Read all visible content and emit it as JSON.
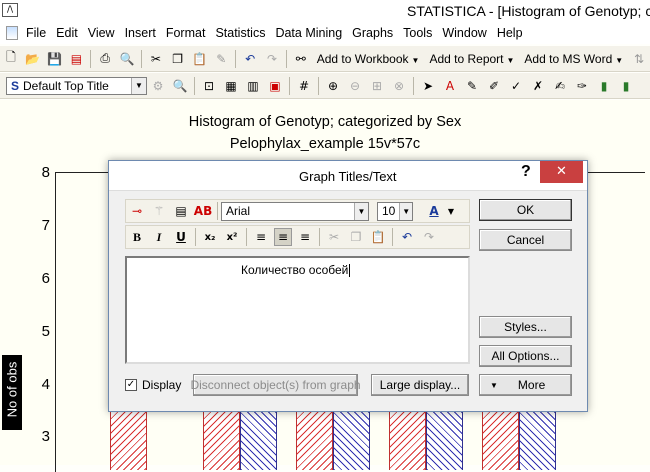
{
  "window": {
    "app_icon": "statistica-app-icon",
    "title": "STATISTICA - [Histogram of Genotyp; c"
  },
  "menu": [
    "File",
    "Edit",
    "View",
    "Insert",
    "Format",
    "Statistics",
    "Data Mining",
    "Graphs",
    "Tools",
    "Window",
    "Help"
  ],
  "toolbar1": {
    "add_to_workbook": "Add to Workbook",
    "add_to_report": "Add to Report",
    "add_to_ms_word": "Add to MS Word"
  },
  "toolbar2": {
    "style_combo": "Default Top Title"
  },
  "chart": {
    "title": "Histogram of Genotyp; categorized by Sex",
    "subtitle": "Pelophylax_example 15v*57c",
    "ylabel": "No of obs",
    "yticks": [
      "8",
      "7",
      "6",
      "5",
      "4",
      "3"
    ],
    "colors": {
      "female": "#d93030",
      "male": "#3030b0"
    }
  },
  "dialog": {
    "title": "Graph Titles/Text",
    "help": "?",
    "close": "✕",
    "font_name": "Arial",
    "font_size": "10",
    "text_content": "Количество особей",
    "display_label": "Display",
    "display_checked": true,
    "disconnect_label": "Disconnect object(s) from graph",
    "large_display_label": "Large display...",
    "ok_label": "OK",
    "cancel_label": "Cancel",
    "styles_label": "Styles...",
    "all_options_label": "All Options...",
    "more_label": "More",
    "bold": "B",
    "italic": "I",
    "underline": "U"
  }
}
